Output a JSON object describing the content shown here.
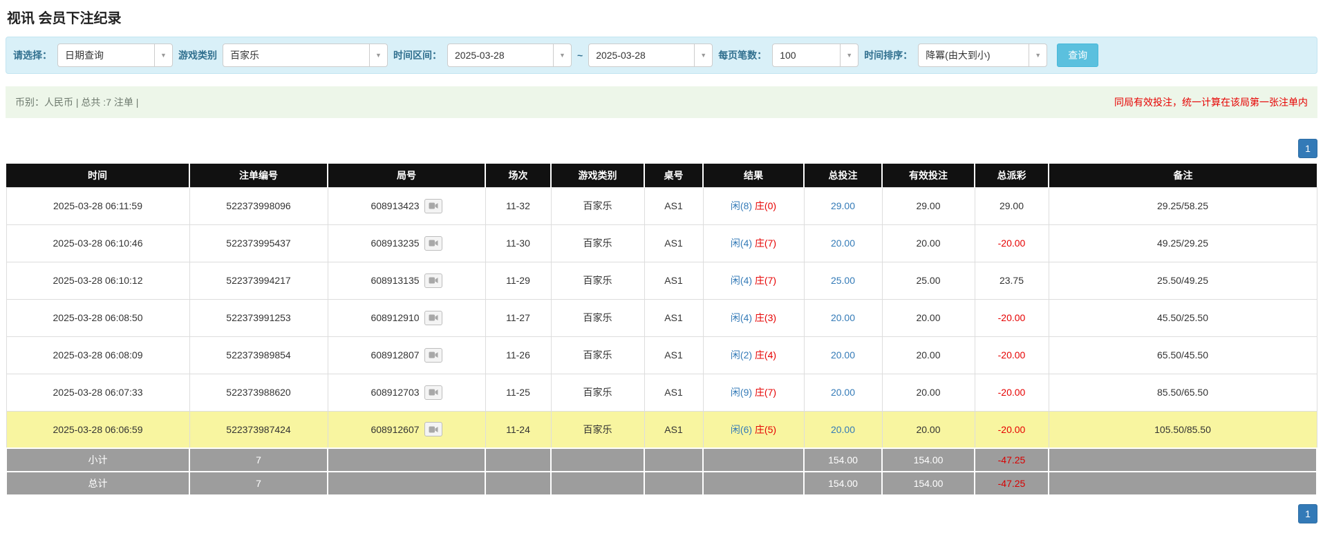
{
  "page": {
    "title": "视讯 会员下注纪录"
  },
  "filters": {
    "select_label": "请选择：",
    "select_value": "日期查询",
    "game_type_label": "游戏类别",
    "game_type_value": "百家乐",
    "time_range_label": "时间区间：",
    "date_from": "2025-03-28",
    "date_separator": "~",
    "date_to": "2025-03-28",
    "page_size_label": "每页笔数：",
    "page_size_value": "100",
    "sort_label": "时间排序：",
    "sort_value": "降冪(由大到小)",
    "search_button": "查询"
  },
  "summary": {
    "left": "币别：人民币 | 总共 :7 注单 |",
    "right": "同局有效投注，统一计算在该局第一张注单内"
  },
  "pagination": {
    "page": "1"
  },
  "colors": {
    "accent_blue": "#337ab7",
    "negative_red": "#e60000",
    "highlight_yellow": "#f8f5a0"
  },
  "icons": {
    "chevron_down": "chevron-down-icon",
    "video": "video-icon"
  },
  "table": {
    "headers": [
      "时间",
      "注单编号",
      "局号",
      "场次",
      "游戏类别",
      "桌号",
      "结果",
      "总投注",
      "有效投注",
      "总派彩",
      "备注"
    ],
    "rows": [
      {
        "time": "2025-03-28 06:11:59",
        "bet_id": "522373998096",
        "round_id": "608913423",
        "session": "11-32",
        "game": "百家乐",
        "table_no": "AS1",
        "result_player": "闲(8)",
        "result_banker": "庄(0)",
        "total_bet": "29.00",
        "valid_bet": "29.00",
        "payout": "29.00",
        "remark": "29.25/58.25",
        "highlight": false
      },
      {
        "time": "2025-03-28 06:10:46",
        "bet_id": "522373995437",
        "round_id": "608913235",
        "session": "11-30",
        "game": "百家乐",
        "table_no": "AS1",
        "result_player": "闲(4)",
        "result_banker": "庄(7)",
        "total_bet": "20.00",
        "valid_bet": "20.00",
        "payout": "-20.00",
        "remark": "49.25/29.25",
        "highlight": false
      },
      {
        "time": "2025-03-28 06:10:12",
        "bet_id": "522373994217",
        "round_id": "608913135",
        "session": "11-29",
        "game": "百家乐",
        "table_no": "AS1",
        "result_player": "闲(4)",
        "result_banker": "庄(7)",
        "total_bet": "25.00",
        "valid_bet": "25.00",
        "payout": "23.75",
        "remark": "25.50/49.25",
        "highlight": false
      },
      {
        "time": "2025-03-28 06:08:50",
        "bet_id": "522373991253",
        "round_id": "608912910",
        "session": "11-27",
        "game": "百家乐",
        "table_no": "AS1",
        "result_player": "闲(4)",
        "result_banker": "庄(3)",
        "total_bet": "20.00",
        "valid_bet": "20.00",
        "payout": "-20.00",
        "remark": "45.50/25.50",
        "highlight": false
      },
      {
        "time": "2025-03-28 06:08:09",
        "bet_id": "522373989854",
        "round_id": "608912807",
        "session": "11-26",
        "game": "百家乐",
        "table_no": "AS1",
        "result_player": "闲(2)",
        "result_banker": "庄(4)",
        "total_bet": "20.00",
        "valid_bet": "20.00",
        "payout": "-20.00",
        "remark": "65.50/45.50",
        "highlight": false
      },
      {
        "time": "2025-03-28 06:07:33",
        "bet_id": "522373988620",
        "round_id": "608912703",
        "session": "11-25",
        "game": "百家乐",
        "table_no": "AS1",
        "result_player": "闲(9)",
        "result_banker": "庄(7)",
        "total_bet": "20.00",
        "valid_bet": "20.00",
        "payout": "-20.00",
        "remark": "85.50/65.50",
        "highlight": false
      },
      {
        "time": "2025-03-28 06:06:59",
        "bet_id": "522373987424",
        "round_id": "608912607",
        "session": "11-24",
        "game": "百家乐",
        "table_no": "AS1",
        "result_player": "闲(6)",
        "result_banker": "庄(5)",
        "total_bet": "20.00",
        "valid_bet": "20.00",
        "payout": "-20.00",
        "remark": "105.50/85.50",
        "highlight": true
      }
    ],
    "subtotal": {
      "label": "小计",
      "count": "7",
      "total_bet": "154.00",
      "valid_bet": "154.00",
      "payout": "-47.25"
    },
    "total": {
      "label": "总计",
      "count": "7",
      "total_bet": "154.00",
      "valid_bet": "154.00",
      "payout": "-47.25"
    }
  }
}
